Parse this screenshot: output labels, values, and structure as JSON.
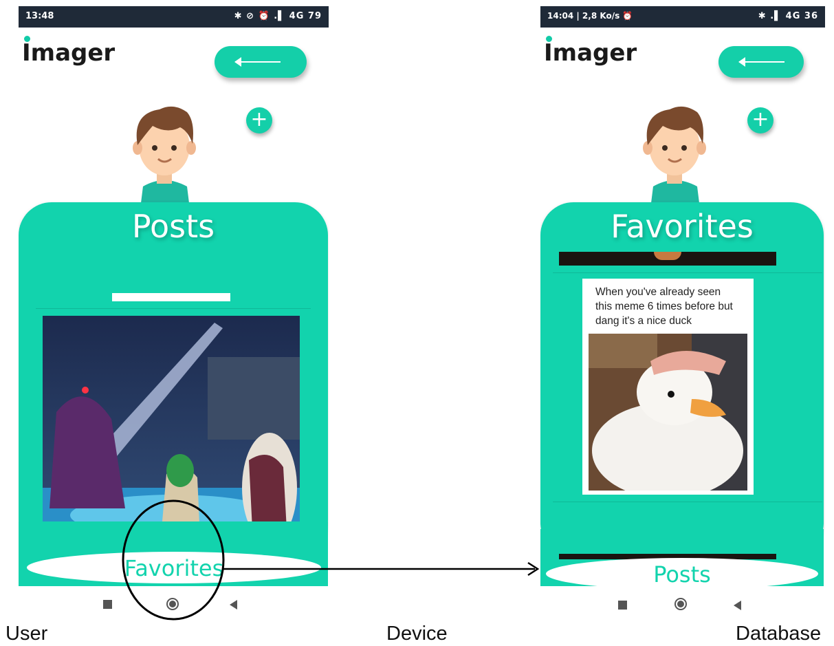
{
  "screens": [
    {
      "status_time": "13:48",
      "status_right": "✱ ⊘ ⏰ .▌ 4G 79",
      "app_title": "Imager",
      "card_title": "Posts",
      "bottom_tab": "Favorites"
    },
    {
      "status_time": "14:04 | 2,8 Ko/s ⏰",
      "status_right": "✱ .▌ 4G 36",
      "app_title": "Imager",
      "card_title": "Favorites",
      "meme_text": "When you've already seen this meme 6 times before but dang it's a nice duck",
      "bottom_tab": "Posts"
    }
  ],
  "captions": {
    "user": "User",
    "device": "Device",
    "database": "Database"
  },
  "colors": {
    "accent": "#12d3ad",
    "status_bar": "#1f2a38",
    "annotation": "#000000"
  },
  "icons": [
    "back-arrow-icon",
    "plus-icon",
    "avatar-icon",
    "nav-square-icon",
    "nav-home-icon",
    "nav-back-icon"
  ]
}
